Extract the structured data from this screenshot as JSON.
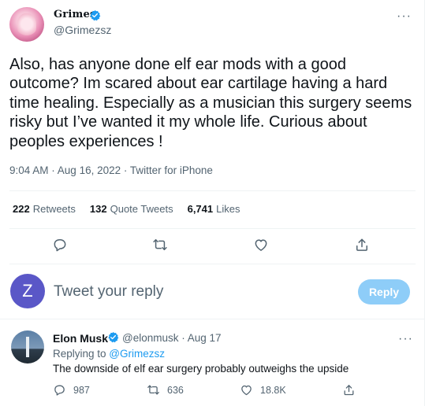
{
  "tweet": {
    "author_name": "Grimes",
    "author_handle": "@Grimezsz",
    "more": "···",
    "text": "Also, has anyone done elf ear mods with a good outcome?  Im scared about ear cartilage having a hard time healing.  Especially as a musician this surgery seems risky but I’ve wanted it my whole life.  Curious about peoples experiences !",
    "time": "9:04 AM",
    "date": "Aug 16, 2022",
    "source": "Twitter for iPhone",
    "separator": " · "
  },
  "stats": {
    "retweets_count": "222",
    "retweets_label": "Retweets",
    "quotes_count": "132",
    "quotes_label": "Quote Tweets",
    "likes_count": "6,741",
    "likes_label": "Likes"
  },
  "actions": [
    "reply-icon",
    "retweet-icon",
    "like-icon",
    "share-icon"
  ],
  "composer": {
    "avatar_letter": "Z",
    "placeholder": "Tweet your reply",
    "button": "Reply"
  },
  "reply": {
    "author_name": "Elon Musk",
    "author_handle": "@elonmusk",
    "separator": " · ",
    "date": "Aug 17",
    "more": "···",
    "replying_prefix": "Replying to ",
    "replying_to": "@Grimezsz",
    "text": "The downside of elf ear surgery probably outweighs the upside",
    "reply_count": "987",
    "retweet_count": "636",
    "like_count": "18.8K"
  },
  "colors": {
    "accent": "#1d9bf0",
    "reply_button": "#8ecdf8",
    "composer_avatar": "#5a57c7",
    "muted_text": "#536471"
  }
}
